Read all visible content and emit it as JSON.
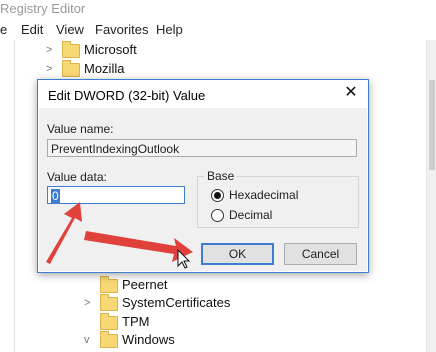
{
  "window": {
    "title": "Registry Editor"
  },
  "menu": [
    "e",
    "Edit",
    "View",
    "Favorites",
    "Help"
  ],
  "tree_top": [
    {
      "label": "Microsoft",
      "chevron": ">"
    },
    {
      "label": "Mozilla",
      "chevron": ">"
    }
  ],
  "tree_bottom": [
    {
      "label": "Peernet",
      "chevron": ""
    },
    {
      "label": "SystemCertificates",
      "chevron": ">"
    },
    {
      "label": "TPM",
      "chevron": ""
    },
    {
      "label": "Windows",
      "chevron": "v"
    }
  ],
  "dialog": {
    "title": "Edit DWORD (32-bit) Value",
    "close_glyph": "✕",
    "value_name_label": "Value name:",
    "value_name": "PreventIndexingOutlook",
    "value_data_label": "Value data:",
    "value_data": "0",
    "base_label": "Base",
    "base_options": [
      "Hexadecimal",
      "Decimal"
    ],
    "base_selected": "Hexadecimal",
    "ok_label": "OK",
    "cancel_label": "Cancel"
  },
  "colors": {
    "accent": "#3e7dd0",
    "annotation_arrow": "#e0413a",
    "folder": "#f8d775"
  },
  "icons": [
    "folder-icon",
    "chevron-right-icon",
    "chevron-down-icon",
    "close-icon",
    "arrow-annotation",
    "mouse-cursor-icon"
  ]
}
